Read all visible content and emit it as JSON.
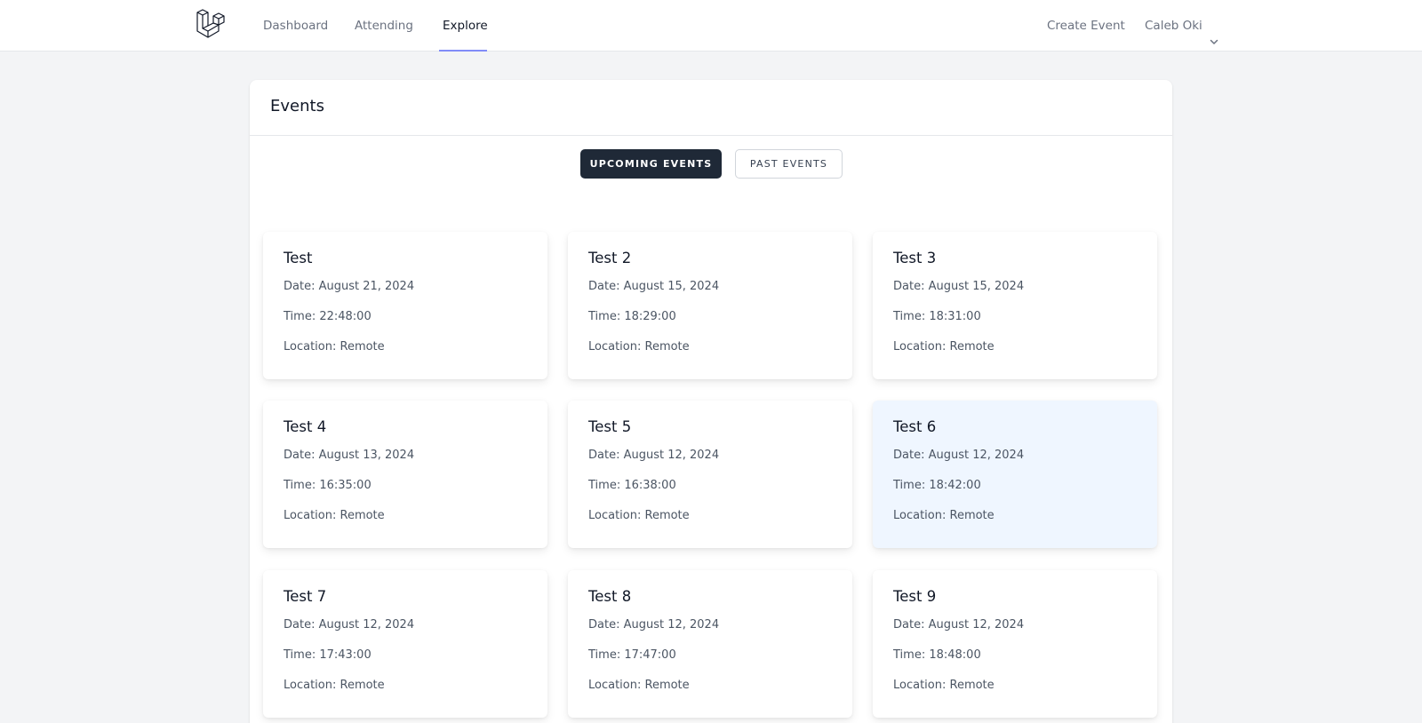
{
  "nav": {
    "links": [
      "Dashboard",
      "Attending",
      "Explore"
    ],
    "active": "Explore",
    "create_event": "Create Event",
    "user_name": "Caleb Oki"
  },
  "page": {
    "title": "Events",
    "tabs": [
      "UPCOMING EVENTS",
      "PAST EVENTS"
    ],
    "active_tab": "UPCOMING EVENTS"
  },
  "events": [
    {
      "title": "Test",
      "date": "Date: August 21, 2024",
      "time": "Time: 22:48:00",
      "location": "Location: Remote"
    },
    {
      "title": "Test 2",
      "date": "Date: August 15, 2024",
      "time": "Time: 18:29:00",
      "location": "Location: Remote"
    },
    {
      "title": "Test 3",
      "date": "Date: August 15, 2024",
      "time": "Time: 18:31:00",
      "location": "Location: Remote"
    },
    {
      "title": "Test 4",
      "date": "Date: August 13, 2024",
      "time": "Time: 16:35:00",
      "location": "Location: Remote"
    },
    {
      "title": "Test 5",
      "date": "Date: August 12, 2024",
      "time": "Time: 16:38:00",
      "location": "Location: Remote"
    },
    {
      "title": "Test 6",
      "date": "Date: August 12, 2024",
      "time": "Time: 18:42:00",
      "location": "Location: Remote"
    },
    {
      "title": "Test 7",
      "date": "Date: August 12, 2024",
      "time": "Time: 17:43:00",
      "location": "Location: Remote"
    },
    {
      "title": "Test 8",
      "date": "Date: August 12, 2024",
      "time": "Time: 17:47:00",
      "location": "Location: Remote"
    },
    {
      "title": "Test 9",
      "date": "Date: August 12, 2024",
      "time": "Time: 18:48:00",
      "location": "Location: Remote"
    }
  ],
  "colors": {
    "active_tab_bg": "#1f2937",
    "nav_underline": "#818cf8",
    "hovered_card_bg": "#eff6ff",
    "page_bg": "#f3f4f6"
  },
  "icons": {
    "logo": "laravel-logo-icon",
    "user_menu": "chevron-down-icon"
  }
}
